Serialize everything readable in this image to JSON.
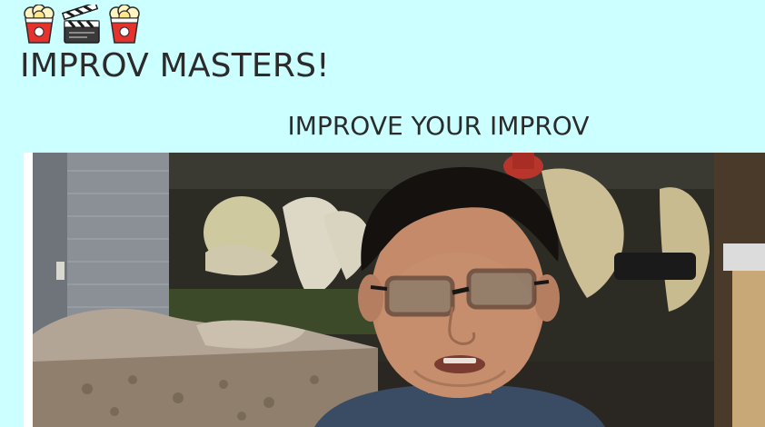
{
  "header": {
    "emoji": [
      {
        "icon": "popcorn-icon"
      },
      {
        "icon": "clapper-board-icon"
      },
      {
        "icon": "popcorn-icon"
      }
    ],
    "title": "IMPROV MASTERS!"
  },
  "main": {
    "tagline": "IMPROVE YOUR IMPROV",
    "video": {
      "icon": "webcam-video-frame"
    }
  },
  "colors": {
    "page_background": "#ccffff",
    "text": "#2b2b2b"
  }
}
